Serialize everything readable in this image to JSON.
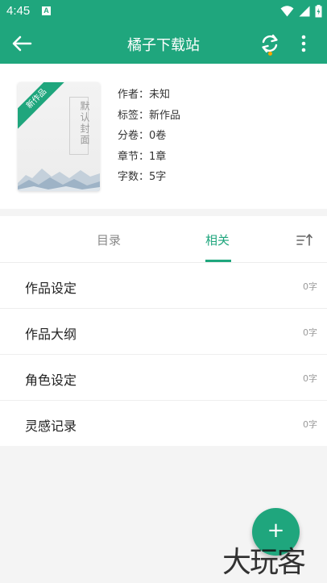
{
  "status_bar": {
    "time": "4:45",
    "notif_badge": "A"
  },
  "app_bar": {
    "title": "橘子下载站"
  },
  "book": {
    "cover_badge": "新作品",
    "cover_title": "默认封面",
    "meta": [
      {
        "label": "作者：",
        "value": "未知"
      },
      {
        "label": "标签：",
        "value": "新作品"
      },
      {
        "label": "分卷：",
        "value": "0卷"
      },
      {
        "label": "章节：",
        "value": "1章"
      },
      {
        "label": "字数：",
        "value": "5字"
      }
    ]
  },
  "tabs": {
    "catalog": "目录",
    "related": "相关",
    "active": "related"
  },
  "list": [
    {
      "label": "作品设定",
      "count": "0字"
    },
    {
      "label": "作品大纲",
      "count": "0字"
    },
    {
      "label": "角色设定",
      "count": "0字"
    },
    {
      "label": "灵感记录",
      "count": "0字"
    }
  ],
  "fab": {
    "symbol": "+"
  },
  "watermark": "大玩客",
  "colors": {
    "primary": "#1fa67d",
    "sync_dot": "#f7a600",
    "background": "#f4f4f4"
  },
  "icons": [
    "back-arrow-icon",
    "sync-icon",
    "more-vert-icon",
    "sort-icon",
    "add-icon",
    "wifi-icon",
    "signal-icon",
    "battery-icon"
  ]
}
